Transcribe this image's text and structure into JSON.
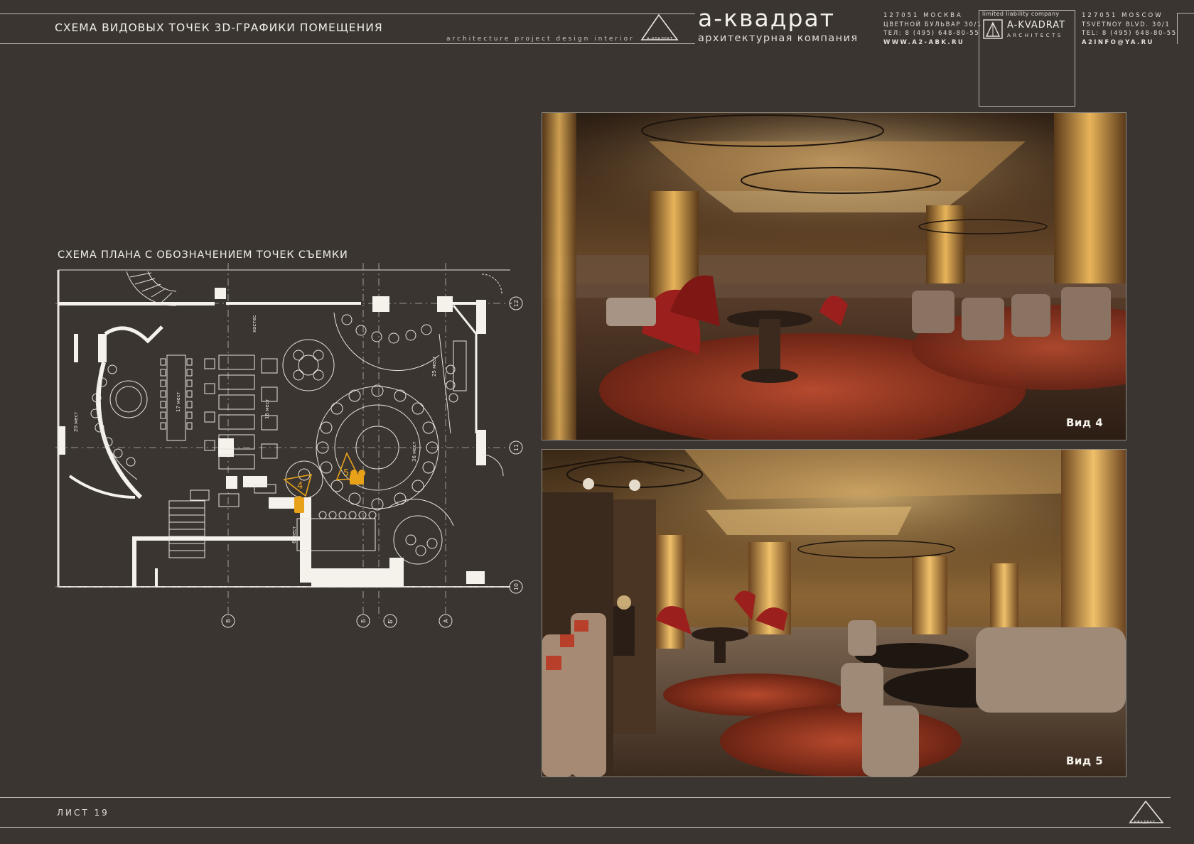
{
  "header": {
    "title": "СХЕМА ВИДОВЫХ ТОЧЕК 3D-ГРАФИКИ ПОМЕЩЕНИЯ",
    "subtitle": "architecture   project   design   interior",
    "logo_caption": "А-КВАДРАТ"
  },
  "brand": {
    "name": "а-квадрат",
    "subtitle": "архитектурная компания",
    "address_ru": [
      "127051 МОСКВА",
      "ЦВЕТНОЙ БУЛЬВАР 30/1",
      "ТЕЛ: 8 (495) 648-80-55",
      "WWW.A2-ABK.RU"
    ],
    "address_en": [
      "127051 MOSCOW",
      "TSVETNOY BLVD. 30/1",
      "TEL: 8 (495) 648-80-55",
      "A2INFO@YA.RU"
    ],
    "llc_caption": "limited liability company",
    "llc_name": "A-KVADRAT",
    "llc_sub": "ARCHITECTS"
  },
  "plan": {
    "title": "СХЕМА ПЛАНА С ОБОЗНАЧЕНИЕМ ТОЧЕК СЪЕМКИ",
    "axes_right": [
      "12",
      "11",
      "10"
    ],
    "axes_bottom": [
      "В",
      "Б",
      "Б'",
      "А"
    ],
    "seat_labels": [
      "20 мест",
      "17 мест",
      "16 мест",
      "36 мест",
      "25 мест",
      "6 мест"
    ],
    "camera_points": [
      "4",
      "5"
    ],
    "room_label": "хостес",
    "accent_color": "#e8a21a"
  },
  "renders": [
    {
      "caption": "Вид 4"
    },
    {
      "caption": "Вид 5"
    }
  ],
  "footer": {
    "sheet": "ЛИСТ 19",
    "logo_caption": "А-КВАДРАТ"
  }
}
